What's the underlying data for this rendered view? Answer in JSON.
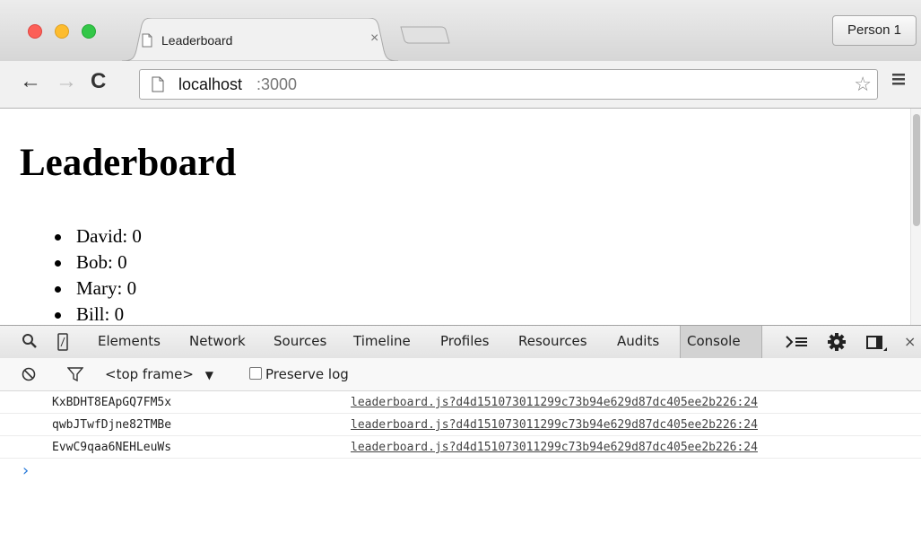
{
  "tab": {
    "title": "Leaderboard",
    "close_glyph": "×"
  },
  "profile": {
    "label": "Person 1"
  },
  "address_bar": {
    "host": "localhost",
    "port": ":3000"
  },
  "page": {
    "heading": "Leaderboard",
    "players": [
      {
        "text": "David: 0"
      },
      {
        "text": "Bob: 0"
      },
      {
        "text": "Mary: 0"
      },
      {
        "text": "Bill: 0"
      }
    ]
  },
  "devtools": {
    "tabs": [
      "Elements",
      "Network",
      "Sources",
      "Timeline",
      "Profiles",
      "Resources",
      "Audits",
      "Console"
    ],
    "selected_tab": "Console",
    "frame_select": "<top frame>",
    "preserve_log_label": "Preserve log",
    "console_rows": [
      {
        "message": "KxBDHT8EApGQ7FM5x",
        "source": "leaderboard.js?d4d151073011299c73b94e629d87dc405ee2b226:24"
      },
      {
        "message": "qwbJTwfDjne82TMBe",
        "source": "leaderboard.js?d4d151073011299c73b94e629d87dc405ee2b226:24"
      },
      {
        "message": "EvwC9qaa6NEHLeuWs",
        "source": "leaderboard.js?d4d151073011299c73b94e629d87dc405ee2b226:24"
      }
    ],
    "prompt_glyph": "›"
  },
  "icons": {
    "back": "←",
    "forward": "→",
    "reload": "C",
    "star": "☆",
    "dropdown": "▼",
    "close": "×"
  },
  "colors": {
    "close_button": "#fc5f57",
    "minimize_button": "#fdbc2e",
    "zoom_button": "#33c748",
    "console_prompt": "#2b7bd9"
  }
}
